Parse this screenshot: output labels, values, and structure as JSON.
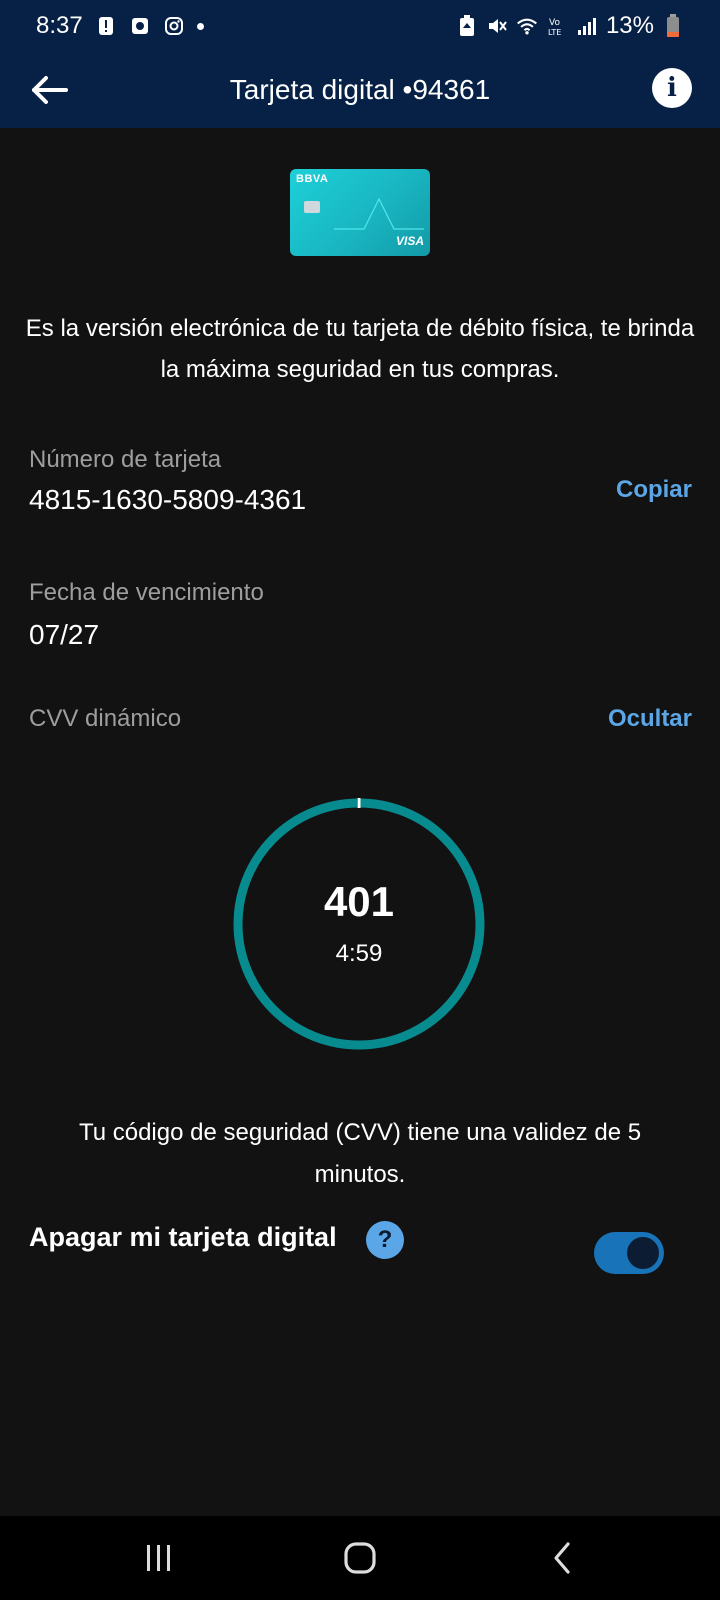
{
  "status_bar": {
    "time": "8:37",
    "battery": "13%",
    "left_icons": [
      "alert-icon",
      "camera-app-icon",
      "instagram-icon",
      "dot-icon"
    ],
    "right_icons": [
      "battery-saver-icon",
      "mute-icon",
      "wifi-icon",
      "volte-icon",
      "signal-icon",
      "battery-icon"
    ]
  },
  "app_bar": {
    "title": "Tarjeta digital •94361"
  },
  "card": {
    "brand": "BBVA",
    "network": "VISA",
    "color": "#1ec5d0"
  },
  "description": "Es la versión electrónica de tu tarjeta de débito física, te brinda la máxima seguridad en tus compras.",
  "card_number": {
    "label": "Número de tarjeta",
    "value": "4815-1630-5809-4361",
    "action": "Copiar"
  },
  "expiry": {
    "label": "Fecha de vencimiento",
    "value": "07/27"
  },
  "cvv": {
    "label": "CVV dinámico",
    "action": "Ocultar",
    "code": "401",
    "timer": "4:59",
    "progress": 0.997,
    "ring_color": "#078b8f"
  },
  "validity_note": "Tu código de seguridad (CVV) tiene una validez de 5 minutos.",
  "turn_off": {
    "label": "Apagar mi tarjeta digital",
    "help": "?",
    "toggle_on": true
  },
  "colors": {
    "header_bg": "#072146",
    "background": "#121212",
    "link": "#5ba6e6"
  }
}
